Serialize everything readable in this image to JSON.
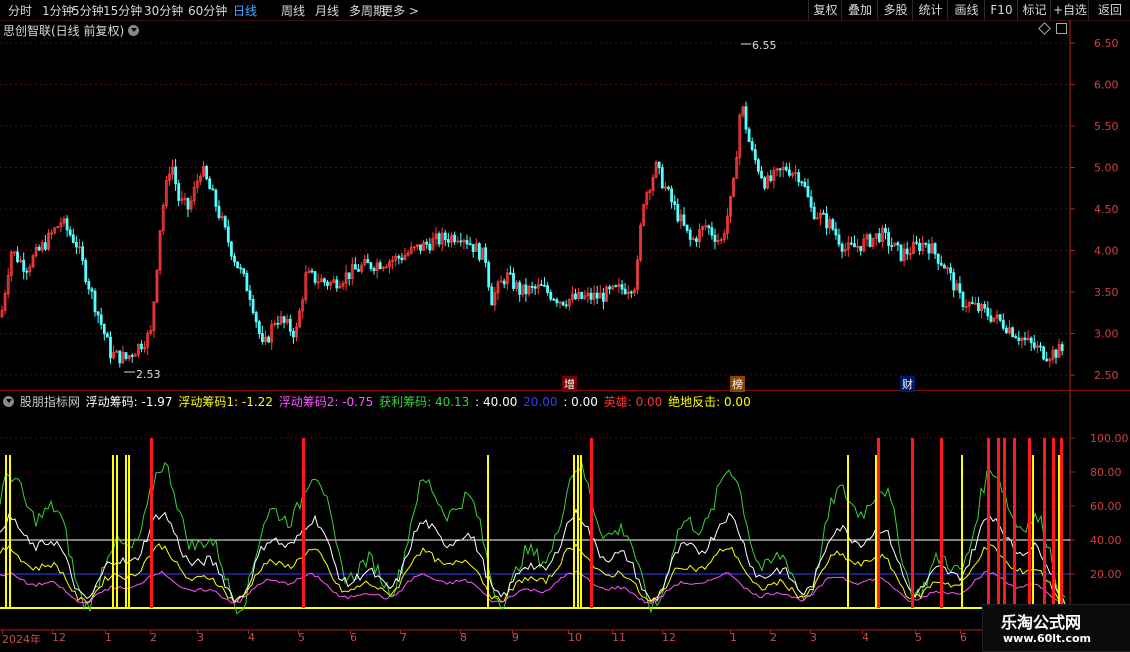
{
  "toolbar": {
    "periods": [
      "分时",
      "1分钟",
      "5分钟",
      "15分钟",
      "30分钟",
      "60分钟",
      "日线",
      "周线",
      "月线",
      "多周期",
      "更多 >"
    ],
    "active": "日线",
    "right_buttons": [
      "复权",
      "叠加",
      "多股",
      "统计",
      "画线",
      "F10",
      "标记",
      "+自选",
      "返回"
    ]
  },
  "main_title": "思创智联(日线 前复权)",
  "main_axis_labels": [
    "6.50",
    "6.00",
    "5.50",
    "5.00",
    "4.50",
    "4.00",
    "3.50",
    "3.00",
    "2.50"
  ],
  "high_label": "6.55",
  "low_label": "2.53",
  "event_markers": [
    "增",
    "榜",
    "财"
  ],
  "indicator_legend": {
    "name": "股朋指标网",
    "items": [
      {
        "label": "浮动筹码: -1.97",
        "color": "#ffffff"
      },
      {
        "label": "浮动筹码1: -1.22",
        "color": "#ffff00"
      },
      {
        "label": "浮动筹码2: -0.75",
        "color": "#ff55ff"
      },
      {
        "label": "获利筹码: 40.13",
        "color": "#3bd23b"
      },
      {
        "label": ": 40.00",
        "color": "#ffffff"
      },
      {
        "label": "20.00",
        "color": "#3b3bff"
      },
      {
        "label": ": 0.00",
        "color": "#ffffff"
      },
      {
        "label": "英雄: 0.00",
        "color": "#ff3030"
      },
      {
        "label": "绝地反击: 0.00",
        "color": "#ffff00"
      }
    ]
  },
  "indicator_axis_labels": [
    "100.00",
    "80.00",
    "60.00",
    "40.00",
    "20.00"
  ],
  "time_axis": [
    "2024年",
    "12",
    "1",
    "2",
    "3",
    "4",
    "5",
    "6",
    "7",
    "8",
    "9",
    "10",
    "11",
    "12",
    "1",
    "2",
    "3",
    "4",
    "5",
    "6"
  ],
  "watermark": {
    "title": "乐淘公式网",
    "url": "www.60lt.com"
  },
  "colors": {
    "up": "#ff3c3c",
    "down": "#54ffff",
    "axis": "#b22222",
    "grid": "#4a0c0c"
  }
}
